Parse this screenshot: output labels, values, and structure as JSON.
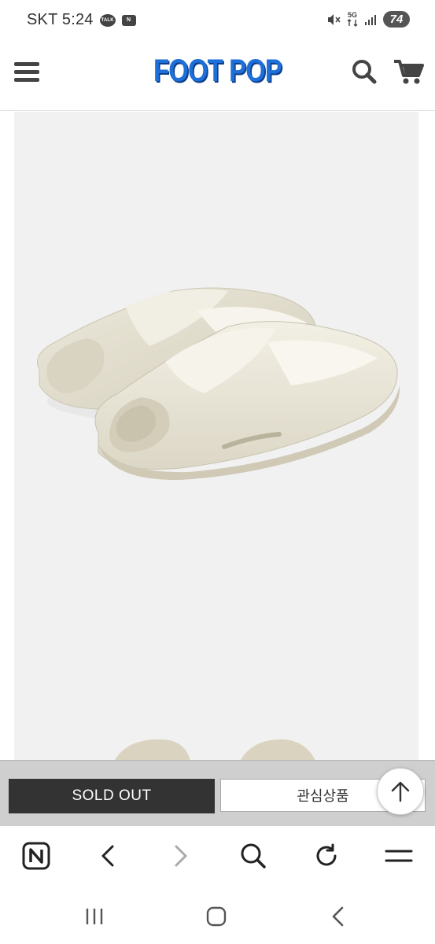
{
  "status_bar": {
    "carrier_time": "SKT 5:24",
    "talk_badge": "TALK",
    "network": "5G",
    "battery": "74"
  },
  "header": {
    "logo": "FOOT POP",
    "icons": [
      "menu-icon",
      "search-icon",
      "cart-icon"
    ]
  },
  "product": {
    "image_alt": "slide-sandal",
    "sandal_color": "#ebe7d9"
  },
  "actions": {
    "sold_out_label": "SOLD OUT",
    "wishlist_label": "관심상품"
  },
  "browser_toolbar": {
    "icons": [
      "naver-icon",
      "back-icon",
      "forward-icon",
      "search-icon",
      "refresh-icon",
      "menu-icon"
    ]
  },
  "system_nav": {
    "icons": [
      "recents-icon",
      "home-icon",
      "back-icon"
    ]
  },
  "colors": {
    "brand_blue": "#1e6fd8",
    "sold_out_bg": "#333333",
    "product_bg": "#f1f1f1"
  }
}
